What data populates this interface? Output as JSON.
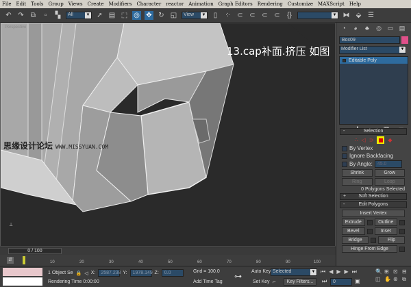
{
  "menu": [
    "File",
    "Edit",
    "Tools",
    "Group",
    "Views",
    "Create",
    "Modifiers",
    "Character",
    "reactor",
    "Animation",
    "Graph Editors",
    "Rendering",
    "Customize",
    "MAXScript",
    "Help"
  ],
  "toolbar": {
    "selection_filter": "All",
    "ref_coord": "View",
    "named_selection": ""
  },
  "viewport": {
    "label": "Perspective",
    "caption": "13.cap补面.挤压 如图",
    "watermark": "思缘设计论坛",
    "watermark_url": "WWW.MISSYUAN.COM"
  },
  "command_panel": {
    "object_name": "Box09",
    "object_color": "#e0508a",
    "modifier_list": "Modifier List",
    "stack_item": "Editable Poly",
    "selection": {
      "title": "Selection",
      "by_vertex": "By Vertex",
      "ignore_backfacing": "Ignore Backfacing",
      "by_angle": "By Angle:",
      "angle_value": "45.0",
      "shrink": "Shrink",
      "grow": "Grow",
      "ring": "Ring",
      "loop": "Loop",
      "status": "0 Polygons Selected"
    },
    "soft_selection": "Soft Selection",
    "edit_polygons": {
      "title": "Edit Polygons",
      "insert_vertex": "Insert Vertex",
      "extrude": "Extrude",
      "outline": "Outline",
      "bevel": "Bevel",
      "inset": "Inset",
      "bridge": "Bridge",
      "flip": "Flip",
      "hinge": "Hinge From Edge"
    }
  },
  "timeline": {
    "frame": "0 / 100",
    "ticks": [
      "10",
      "20",
      "30",
      "40",
      "50",
      "60",
      "70",
      "80",
      "90",
      "100"
    ]
  },
  "status": {
    "selection": "1 Object Se",
    "x_label": "X:",
    "x": "2587.238",
    "y_label": "Y:",
    "y": "1978.149",
    "z_label": "Z:",
    "z": "0.0",
    "grid": "Grid = 100.0",
    "rendering_time": "Rendering Time  0:00:00",
    "add_time_tag": "Add Time Tag",
    "auto_key": "Auto Key",
    "key_mode": "Selected",
    "set_key": "Set Key",
    "key_filters": "Key Filters...",
    "current_frame": "0"
  }
}
